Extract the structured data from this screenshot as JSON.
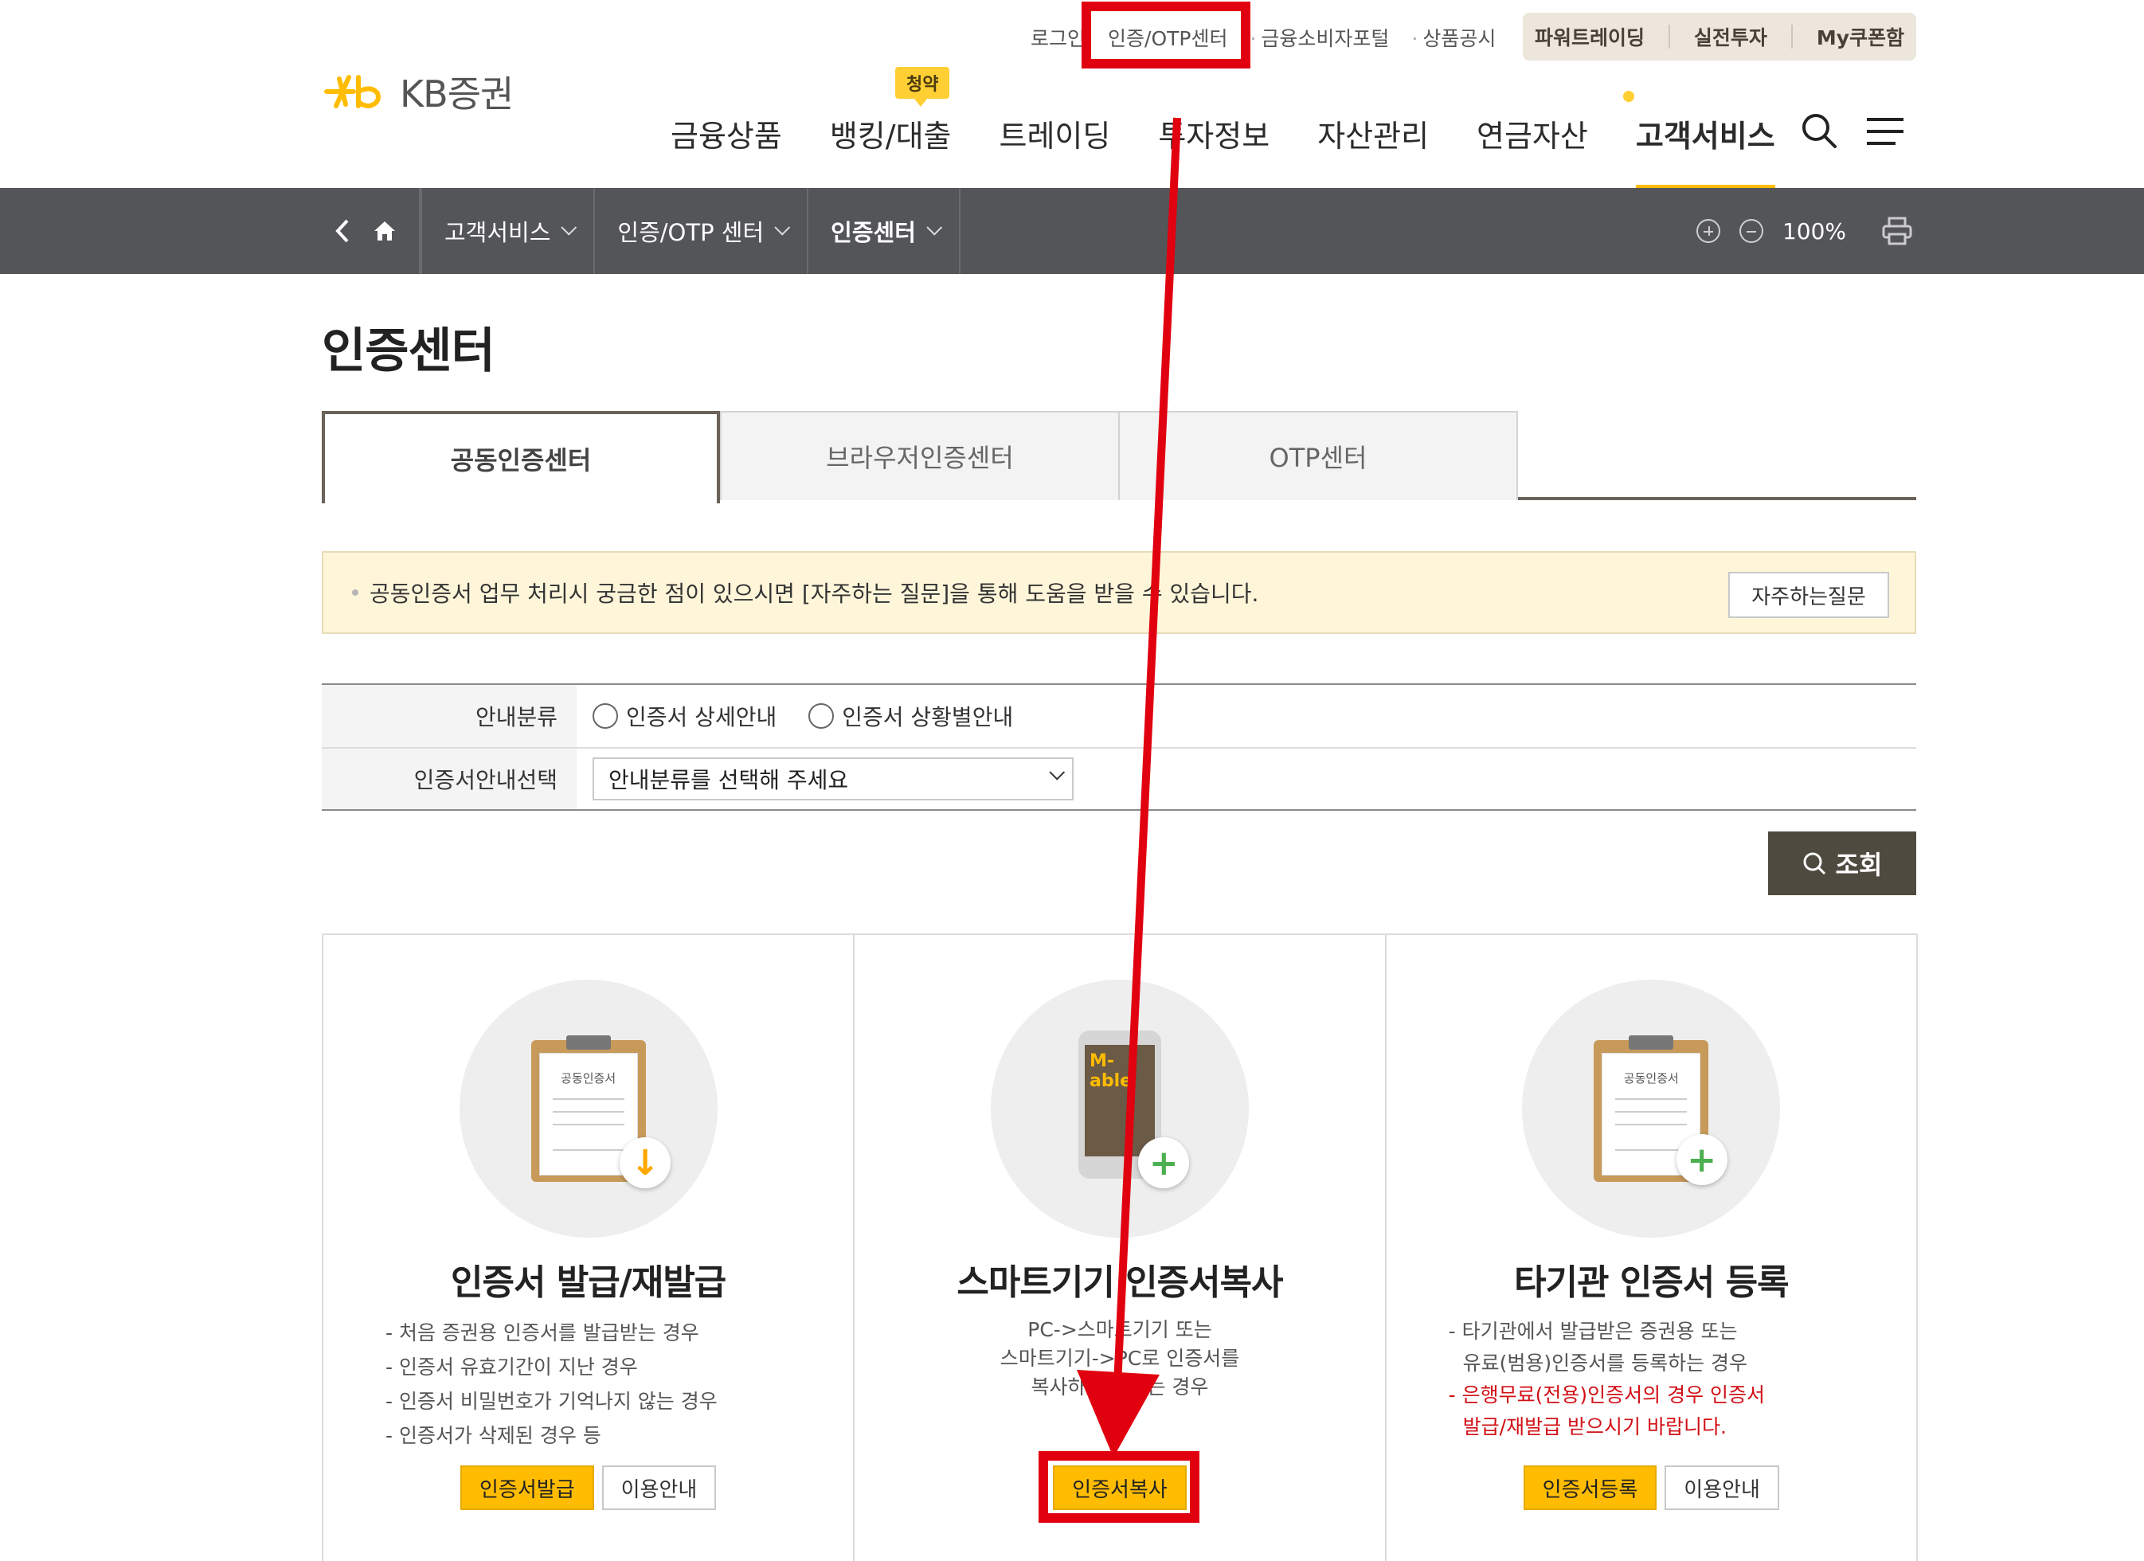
{
  "utility": {
    "links": [
      "로그인",
      "인증/OTP센터",
      "금융소비자포털",
      "상품공시"
    ],
    "buttons": [
      "파워트레이딩",
      "실전투자",
      "My쿠폰함"
    ]
  },
  "logo": {
    "text": "KB증권"
  },
  "gnb": {
    "badge": "청약",
    "items": [
      "금융상품",
      "뱅킹/대출",
      "트레이딩",
      "투자정보",
      "자산관리",
      "연금자산",
      "고객서비스"
    ]
  },
  "location": {
    "crumbs": [
      "고객서비스",
      "인증/OTP 센터",
      "인증센터"
    ],
    "zoom": "100%"
  },
  "page_title": "인증센터",
  "tabs": [
    "공동인증센터",
    "브라우저인증센터",
    "OTP센터"
  ],
  "notice": {
    "text": "공동인증서 업무 처리시 궁금한 점이 있으시면 [자주하는 질문]을 통해 도움을 받을 수 있습니다.",
    "button": "자주하는질문"
  },
  "form": {
    "row1_label": "안내분류",
    "radio1": "인증서 상세안내",
    "radio2": "인증서 상황별안내",
    "row2_label": "인증서안내선택",
    "select_value": "안내분류를 선택해 주세요",
    "search_button": "조회"
  },
  "cards": [
    {
      "title": "인증서 발급/재발급",
      "desc": [
        "- 처음 증권용 인증서를 발급받는 경우",
        "- 인증서 유효기간이 지난 경우",
        "- 인증서 비밀번호가 기억나지 않는 경우",
        "- 인증서가 삭제된 경우 등"
      ],
      "btn_primary": "인증서발급",
      "btn_secondary": "이용안내",
      "illus_text": "공동인증서"
    },
    {
      "title": "스마트기기 인증서복사",
      "desc": [
        "PC->스마트기기 또는",
        "스마트기기->PC로 인증서를",
        "복사하고자 하는 경우"
      ],
      "btn_primary": "인증서복사",
      "illus_text": "M-able"
    },
    {
      "title": "타기관 인증서 등록",
      "desc": [
        "- 타기관에서 발급받은 증권용 또는",
        "유료(범용)인증서를 등록하는 경우"
      ],
      "desc_red": [
        "- 은행무료(전용)인증서의 경우 인증서",
        "발급/재발급 받으시기 바랍니다."
      ],
      "btn_primary": "인증서등록",
      "btn_secondary": "이용안내",
      "illus_text": "공동인증서"
    }
  ],
  "colors": {
    "accent": "#ffbc00",
    "highlight": "#e1000f",
    "locbar": "#545559"
  }
}
